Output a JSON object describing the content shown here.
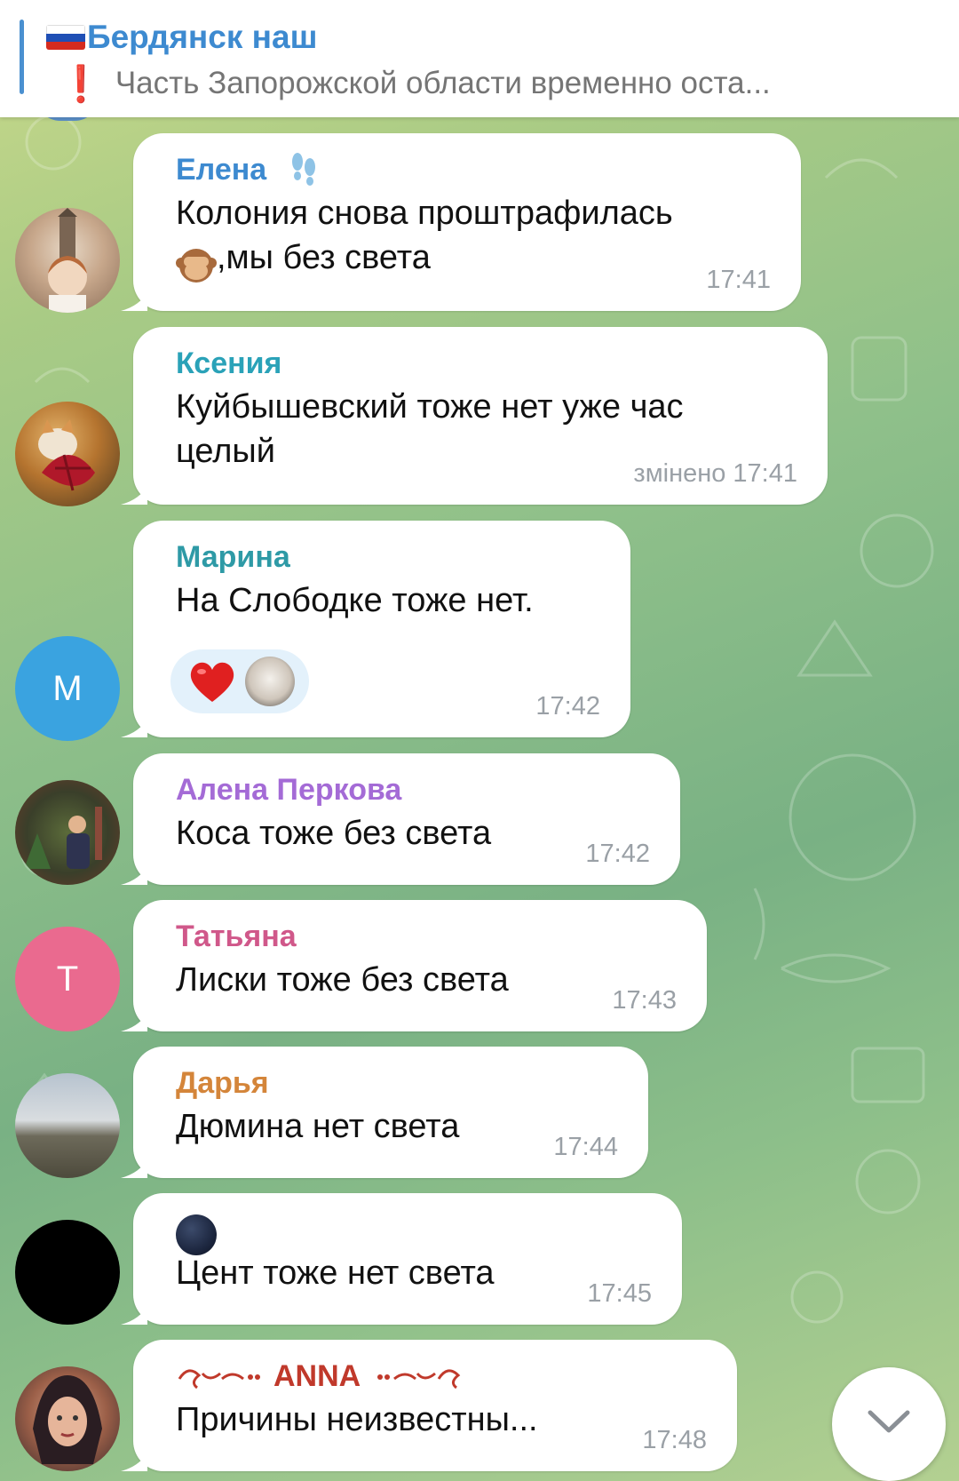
{
  "pinned": {
    "title": "Бердянск наш",
    "subtitle": "Часть Запорожской области временно оста..."
  },
  "messages": [
    {
      "sender": "Елена",
      "text_lines": [
        "Колония снова проштрафилась",
        ",мы без света"
      ],
      "time": "17:41",
      "sender_color": "#3d8ad0"
    },
    {
      "sender": "Ксения",
      "text_lines": [
        "Куйбышевский тоже нет уже час",
        "целый"
      ],
      "time": "змінено 17:41",
      "sender_color": "#2aa2b8"
    },
    {
      "sender": "Марина",
      "text_lines": [
        "На Слободке тоже нет."
      ],
      "time": "17:42",
      "sender_color": "#2e9aa6",
      "avatar_letter": "М",
      "avatar_color": "#3aa3e0",
      "reactions": [
        "heart-icon",
        "cat-avatar"
      ]
    },
    {
      "sender": "Алена Перкова",
      "text_lines": [
        "Коса тоже без света"
      ],
      "time": "17:42",
      "sender_color": "#a46bd6"
    },
    {
      "sender": "Татьяна",
      "text_lines": [
        "Лиски тоже без света"
      ],
      "time": "17:43",
      "sender_color": "#d0588a",
      "avatar_letter": "Т",
      "avatar_color": "#ea6a8f"
    },
    {
      "sender": "Дарья",
      "text_lines": [
        "Дюмина нет света"
      ],
      "time": "17:44",
      "sender_color": "#d4853a"
    },
    {
      "sender": "",
      "text_lines": [
        "Цент тоже нет света"
      ],
      "time": "17:45"
    },
    {
      "sender": "ANNA",
      "text_lines": [
        "Причины неизвестны..."
      ],
      "time": "17:48",
      "sender_color": "#c0392b"
    }
  ]
}
